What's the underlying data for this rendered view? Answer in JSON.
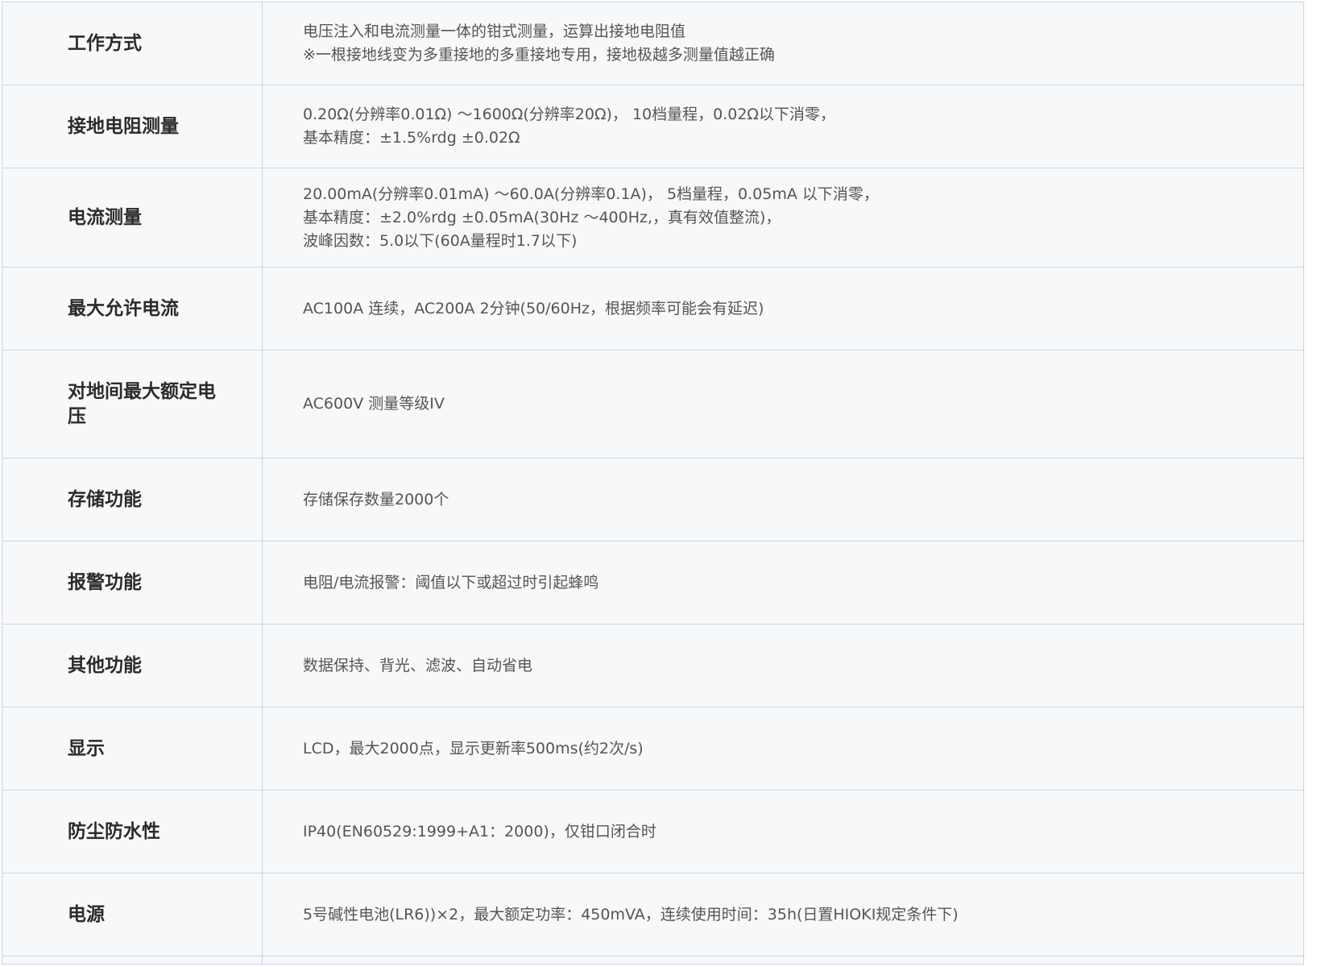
{
  "spec_table": {
    "rows": [
      {
        "label": "工作方式",
        "lines": [
          "电压注入和电流测量一体的钳式测量，运算出接地电阻值",
          "※一根接地线变为多重接地的多重接地专用，接地极越多测量值越正确"
        ]
      },
      {
        "label": "接地电阻测量",
        "lines": [
          "0.20Ω(分辨率0.01Ω) ～1600Ω(分辨率20Ω)， 10档量程，0.02Ω以下消零，",
          "基本精度：±1.5%rdg ±0.02Ω"
        ]
      },
      {
        "label": "电流测量",
        "lines": [
          "20.00mA(分辨率0.01mA) ～60.0A(分辨率0.1A)， 5档量程，0.05mA 以下消零，",
          "基本精度：±2.0%rdg ±0.05mA(30Hz ～400Hz,，真有效值整流)，",
          "波峰因数：5.0以下(60A量程时1.7以下)"
        ]
      },
      {
        "label": "最大允许电流",
        "lines": [
          "AC100A 连续，AC200A 2分钟(50/60Hz，根据频率可能会有延迟)"
        ]
      },
      {
        "label": "对地间最大额定电压",
        "lines": [
          "AC600V 测量等级IV"
        ]
      },
      {
        "label": "存储功能",
        "lines": [
          "存储保存数量2000个"
        ]
      },
      {
        "label": "报警功能",
        "lines": [
          "电阻/电流报警：阈值以下或超过时引起蜂鸣"
        ]
      },
      {
        "label": "其他功能",
        "lines": [
          "数据保持、背光、滤波、自动省电"
        ]
      },
      {
        "label": "显示",
        "lines": [
          "LCD，最大2000点，显示更新率500ms(约2次/s)"
        ]
      },
      {
        "label": "防尘防水性",
        "lines": [
          "IP40(EN60529:1999+A1：2000)，仅钳口闭合时"
        ]
      },
      {
        "label": "电源",
        "lines": [
          "5号碱性电池(LR6))×2，最大额定功率：450mVA，连续使用时间：35h(日置HIOKI规定条件下)"
        ]
      }
    ]
  },
  "colors": {
    "cell_background": "#f7f8fa",
    "border": "#c9d3e6",
    "label_text": "#2b2b2b",
    "value_text": "#555555"
  }
}
